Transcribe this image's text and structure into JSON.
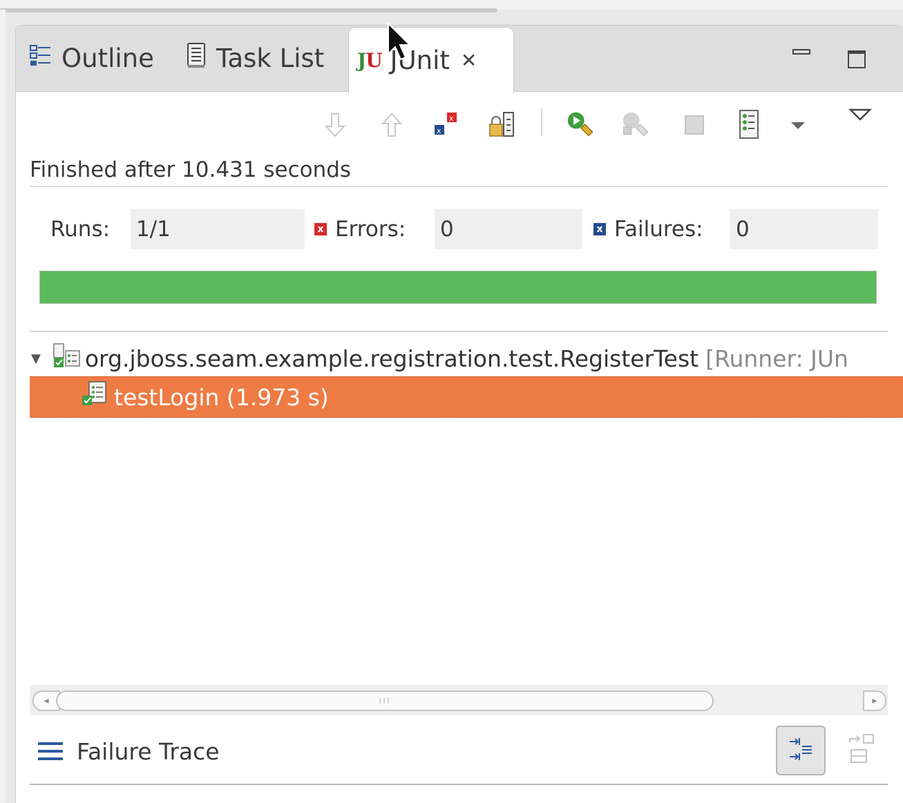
{
  "tabs": {
    "outline": "Outline",
    "task_list": "Task List",
    "junit": "JUnit",
    "junit_logo_j": "J",
    "junit_logo_u": "U",
    "close_glyph": "✕"
  },
  "toolbar": {
    "icons": [
      "next-failure-icon",
      "previous-failure-icon",
      "show-failures-only-icon",
      "scroll-lock-icon",
      "rerun-test-icon",
      "rerun-failed-first-icon",
      "stop-icon",
      "test-run-history-icon",
      "history-dropdown-icon",
      "view-menu-icon"
    ]
  },
  "status": {
    "text": "Finished after 10.431 seconds"
  },
  "counters": {
    "runs_label": "Runs:",
    "runs_value": "1/1",
    "errors_label": "Errors:",
    "errors_value": "0",
    "failures_label": "Failures:",
    "failures_value": "0"
  },
  "progress": {
    "fraction": 1.0,
    "color": "#5cbb5c"
  },
  "tree": {
    "suite_name": "org.jboss.seam.example.registration.test.RegisterTest",
    "suite_runner": "[Runner: JUn",
    "test_name": "testLogin (1.973 s)",
    "selected_color": "#ef7b45"
  },
  "failure_trace": {
    "title": "Failure Trace"
  }
}
